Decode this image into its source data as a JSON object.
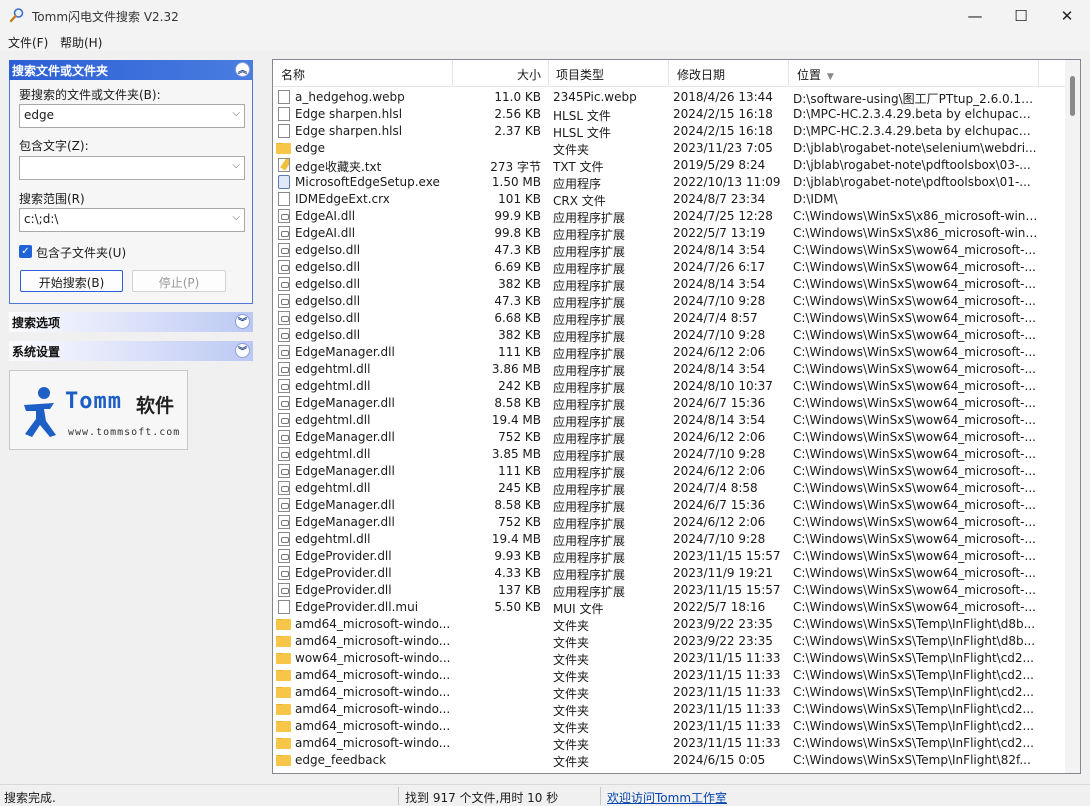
{
  "window": {
    "title": "Tomm闪电文件搜索 V2.32",
    "minimize": "—",
    "maximize": "☐",
    "close": "✕"
  },
  "menu": {
    "file": "文件(F)",
    "help": "帮助(H)"
  },
  "sidebar": {
    "search_panel_title": "搜索文件或文件夹",
    "name_label": "要搜索的文件或文件夹(B):",
    "name_value": "edge",
    "text_label": "包含文字(Z):",
    "text_value": "",
    "scope_label": "搜索范围(R)",
    "scope_value": "c:\\;d:\\",
    "subfolder_label": "包含子文件夹(U)",
    "subfolder_checked": true,
    "start_button": "开始搜索(B)",
    "stop_button": "停止(P)",
    "options_title": "搜索选项",
    "settings_title": "系统设置",
    "logo_brand": "Tomm",
    "logo_cn": "软件",
    "logo_url": "www.tommsoft.com"
  },
  "list": {
    "columns": {
      "name": "名称",
      "size": "大小",
      "type": "项目类型",
      "date": "修改日期",
      "location": "位置"
    },
    "rows": [
      {
        "icon": "file",
        "name": "a_hedgehog.webp",
        "size": "11.0 KB",
        "type": "2345Pic.webp",
        "date": "2018/4/26 13:44",
        "loc": "D:\\software-using\\图工厂PTtup_2.6.0.1_G..."
      },
      {
        "icon": "file",
        "name": "Edge sharpen.hlsl",
        "size": "2.56 KB",
        "type": "HLSL 文件",
        "date": "2024/2/15 16:18",
        "loc": "D:\\MPC-HC.2.3.4.29.beta by elchupacab..."
      },
      {
        "icon": "file",
        "name": "Edge sharpen.hlsl",
        "size": "2.37 KB",
        "type": "HLSL 文件",
        "date": "2024/2/15 16:18",
        "loc": "D:\\MPC-HC.2.3.4.29.beta by elchupacab..."
      },
      {
        "icon": "folder",
        "name": "edge",
        "size": "",
        "type": "文件夹",
        "date": "2023/11/23 7:05",
        "loc": "D:\\jblab\\rogabet-note\\selenium\\webdri..."
      },
      {
        "icon": "txt",
        "name": "edge收藏夹.txt",
        "size": "273 字节",
        "type": "TXT 文件",
        "date": "2019/5/29 8:24",
        "loc": "D:\\jblab\\rogabet-note\\pdftoolsbox\\03-..."
      },
      {
        "icon": "exe",
        "name": "MicrosoftEdgeSetup.exe",
        "size": "1.50 MB",
        "type": "应用程序",
        "date": "2022/10/13 11:09",
        "loc": "D:\\jblab\\rogabet-note\\pdftoolsbox\\01-..."
      },
      {
        "icon": "file",
        "name": "IDMEdgeExt.crx",
        "size": "101 KB",
        "type": "CRX 文件",
        "date": "2024/8/7 23:34",
        "loc": "D:\\IDM\\"
      },
      {
        "icon": "dll",
        "name": "EdgeAI.dll",
        "size": "99.9 KB",
        "type": "应用程序扩展",
        "date": "2024/7/25 12:28",
        "loc": "C:\\Windows\\WinSxS\\x86_microsoft-wind..."
      },
      {
        "icon": "dll",
        "name": "EdgeAI.dll",
        "size": "99.8 KB",
        "type": "应用程序扩展",
        "date": "2022/5/7 13:19",
        "loc": "C:\\Windows\\WinSxS\\x86_microsoft-wind..."
      },
      {
        "icon": "dll",
        "name": "edgeIso.dll",
        "size": "47.3 KB",
        "type": "应用程序扩展",
        "date": "2024/8/14 3:54",
        "loc": "C:\\Windows\\WinSxS\\wow64_microsoft-..."
      },
      {
        "icon": "dll",
        "name": "edgeIso.dll",
        "size": "6.69 KB",
        "type": "应用程序扩展",
        "date": "2024/7/26 6:17",
        "loc": "C:\\Windows\\WinSxS\\wow64_microsoft-..."
      },
      {
        "icon": "dll",
        "name": "edgeIso.dll",
        "size": "382 KB",
        "type": "应用程序扩展",
        "date": "2024/8/14 3:54",
        "loc": "C:\\Windows\\WinSxS\\wow64_microsoft-..."
      },
      {
        "icon": "dll",
        "name": "edgeIso.dll",
        "size": "47.3 KB",
        "type": "应用程序扩展",
        "date": "2024/7/10 9:28",
        "loc": "C:\\Windows\\WinSxS\\wow64_microsoft-..."
      },
      {
        "icon": "dll",
        "name": "edgeIso.dll",
        "size": "6.68 KB",
        "type": "应用程序扩展",
        "date": "2024/7/4 8:57",
        "loc": "C:\\Windows\\WinSxS\\wow64_microsoft-..."
      },
      {
        "icon": "dll",
        "name": "edgeIso.dll",
        "size": "382 KB",
        "type": "应用程序扩展",
        "date": "2024/7/10 9:28",
        "loc": "C:\\Windows\\WinSxS\\wow64_microsoft-..."
      },
      {
        "icon": "dll",
        "name": "EdgeManager.dll",
        "size": "111 KB",
        "type": "应用程序扩展",
        "date": "2024/6/12 2:06",
        "loc": "C:\\Windows\\WinSxS\\wow64_microsoft-..."
      },
      {
        "icon": "dll",
        "name": "edgehtml.dll",
        "size": "3.86 MB",
        "type": "应用程序扩展",
        "date": "2024/8/14 3:54",
        "loc": "C:\\Windows\\WinSxS\\wow64_microsoft-..."
      },
      {
        "icon": "dll",
        "name": "edgehtml.dll",
        "size": "242 KB",
        "type": "应用程序扩展",
        "date": "2024/8/10 10:37",
        "loc": "C:\\Windows\\WinSxS\\wow64_microsoft-..."
      },
      {
        "icon": "dll",
        "name": "EdgeManager.dll",
        "size": "8.58 KB",
        "type": "应用程序扩展",
        "date": "2024/6/7 15:36",
        "loc": "C:\\Windows\\WinSxS\\wow64_microsoft-..."
      },
      {
        "icon": "dll",
        "name": "edgehtml.dll",
        "size": "19.4 MB",
        "type": "应用程序扩展",
        "date": "2024/8/14 3:54",
        "loc": "C:\\Windows\\WinSxS\\wow64_microsoft-..."
      },
      {
        "icon": "dll",
        "name": "EdgeManager.dll",
        "size": "752 KB",
        "type": "应用程序扩展",
        "date": "2024/6/12 2:06",
        "loc": "C:\\Windows\\WinSxS\\wow64_microsoft-..."
      },
      {
        "icon": "dll",
        "name": "edgehtml.dll",
        "size": "3.85 MB",
        "type": "应用程序扩展",
        "date": "2024/7/10 9:28",
        "loc": "C:\\Windows\\WinSxS\\wow64_microsoft-..."
      },
      {
        "icon": "dll",
        "name": "EdgeManager.dll",
        "size": "111 KB",
        "type": "应用程序扩展",
        "date": "2024/6/12 2:06",
        "loc": "C:\\Windows\\WinSxS\\wow64_microsoft-..."
      },
      {
        "icon": "dll",
        "name": "edgehtml.dll",
        "size": "245 KB",
        "type": "应用程序扩展",
        "date": "2024/7/4 8:58",
        "loc": "C:\\Windows\\WinSxS\\wow64_microsoft-..."
      },
      {
        "icon": "dll",
        "name": "EdgeManager.dll",
        "size": "8.58 KB",
        "type": "应用程序扩展",
        "date": "2024/6/7 15:36",
        "loc": "C:\\Windows\\WinSxS\\wow64_microsoft-..."
      },
      {
        "icon": "dll",
        "name": "EdgeManager.dll",
        "size": "752 KB",
        "type": "应用程序扩展",
        "date": "2024/6/12 2:06",
        "loc": "C:\\Windows\\WinSxS\\wow64_microsoft-..."
      },
      {
        "icon": "dll",
        "name": "edgehtml.dll",
        "size": "19.4 MB",
        "type": "应用程序扩展",
        "date": "2024/7/10 9:28",
        "loc": "C:\\Windows\\WinSxS\\wow64_microsoft-..."
      },
      {
        "icon": "dll",
        "name": "EdgeProvider.dll",
        "size": "9.93 KB",
        "type": "应用程序扩展",
        "date": "2023/11/15 15:57",
        "loc": "C:\\Windows\\WinSxS\\wow64_microsoft-..."
      },
      {
        "icon": "dll",
        "name": "EdgeProvider.dll",
        "size": "4.33 KB",
        "type": "应用程序扩展",
        "date": "2023/11/9 19:21",
        "loc": "C:\\Windows\\WinSxS\\wow64_microsoft-..."
      },
      {
        "icon": "dll",
        "name": "EdgeProvider.dll",
        "size": "137 KB",
        "type": "应用程序扩展",
        "date": "2023/11/15 15:57",
        "loc": "C:\\Windows\\WinSxS\\wow64_microsoft-..."
      },
      {
        "icon": "file",
        "name": "EdgeProvider.dll.mui",
        "size": "5.50 KB",
        "type": "MUI 文件",
        "date": "2022/5/7 18:16",
        "loc": "C:\\Windows\\WinSxS\\wow64_microsoft-..."
      },
      {
        "icon": "folder",
        "name": "amd64_microsoft-windo...",
        "size": "",
        "type": "文件夹",
        "date": "2023/9/22 23:35",
        "loc": "C:\\Windows\\WinSxS\\Temp\\InFlight\\d8b..."
      },
      {
        "icon": "folder",
        "name": "amd64_microsoft-windo...",
        "size": "",
        "type": "文件夹",
        "date": "2023/9/22 23:35",
        "loc": "C:\\Windows\\WinSxS\\Temp\\InFlight\\d8b..."
      },
      {
        "icon": "folder",
        "name": "wow64_microsoft-windo...",
        "size": "",
        "type": "文件夹",
        "date": "2023/11/15 11:33",
        "loc": "C:\\Windows\\WinSxS\\Temp\\InFlight\\cd2..."
      },
      {
        "icon": "folder",
        "name": "amd64_microsoft-windo...",
        "size": "",
        "type": "文件夹",
        "date": "2023/11/15 11:33",
        "loc": "C:\\Windows\\WinSxS\\Temp\\InFlight\\cd2..."
      },
      {
        "icon": "folder",
        "name": "amd64_microsoft-windo...",
        "size": "",
        "type": "文件夹",
        "date": "2023/11/15 11:33",
        "loc": "C:\\Windows\\WinSxS\\Temp\\InFlight\\cd2..."
      },
      {
        "icon": "folder",
        "name": "amd64_microsoft-windo...",
        "size": "",
        "type": "文件夹",
        "date": "2023/11/15 11:33",
        "loc": "C:\\Windows\\WinSxS\\Temp\\InFlight\\cd2..."
      },
      {
        "icon": "folder",
        "name": "amd64_microsoft-windo...",
        "size": "",
        "type": "文件夹",
        "date": "2023/11/15 11:33",
        "loc": "C:\\Windows\\WinSxS\\Temp\\InFlight\\cd2..."
      },
      {
        "icon": "folder",
        "name": "amd64_microsoft-windo...",
        "size": "",
        "type": "文件夹",
        "date": "2023/11/15 11:33",
        "loc": "C:\\Windows\\WinSxS\\Temp\\InFlight\\cd2..."
      },
      {
        "icon": "folder",
        "name": "edge_feedback",
        "size": "",
        "type": "文件夹",
        "date": "2024/6/15 0:05",
        "loc": "C:\\Windows\\WinSxS\\Temp\\InFlight\\82f..."
      }
    ]
  },
  "status": {
    "left": "搜索完成.",
    "middle": "找到 917 个文件,用时 10 秒",
    "link": "欢迎访问Tomm工作室"
  },
  "colors": {
    "accent": "#2b5fd4",
    "link": "#0645ad",
    "folder": "#f7c648"
  }
}
